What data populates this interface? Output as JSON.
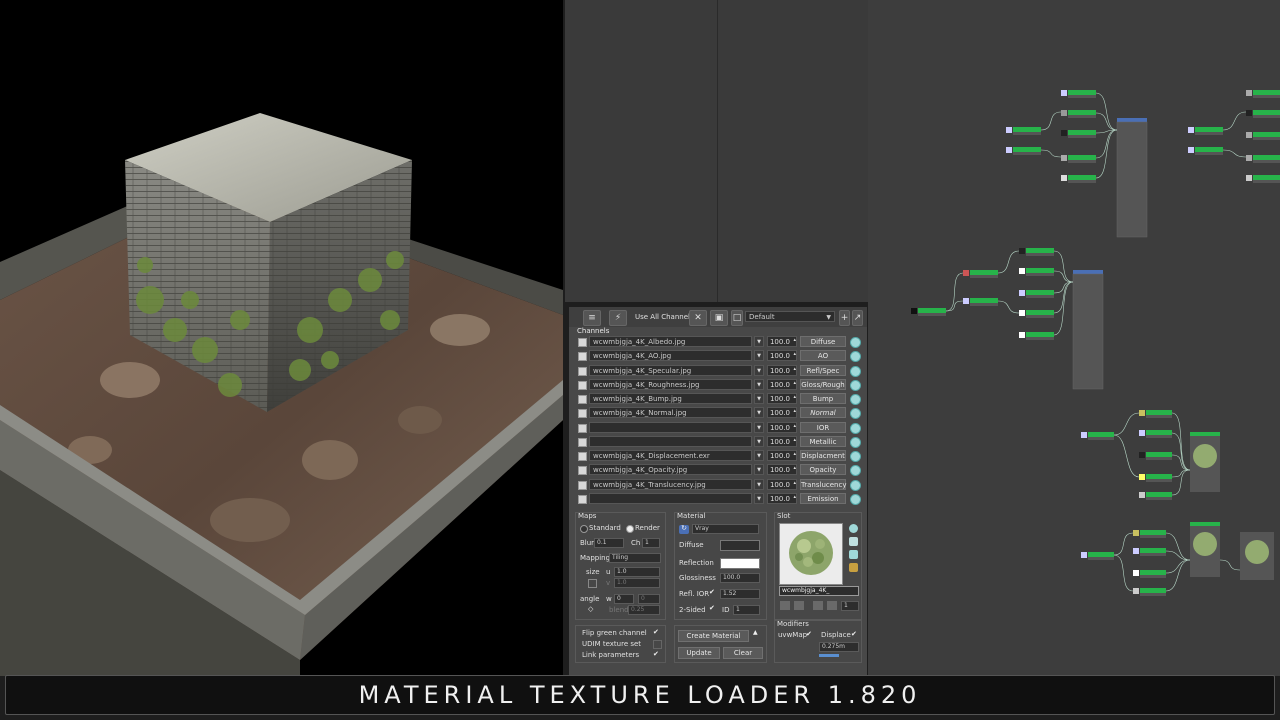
{
  "toolbar": {
    "use_all_channels": "Use All Channels",
    "preset": "Default"
  },
  "channels": {
    "title": "Channels",
    "rows": [
      {
        "file": "wcwmbjgja_4K_Albedo.jpg",
        "value": "100.0",
        "channel": "Diffuse"
      },
      {
        "file": "wcwmbjgja_4K_AO.jpg",
        "value": "100.0",
        "channel": "AO"
      },
      {
        "file": "wcwmbjgja_4K_Specular.jpg",
        "value": "100.0",
        "channel": "Refl/Spec"
      },
      {
        "file": "wcwmbjgja_4K_Roughness.jpg",
        "value": "100.0",
        "channel": "Gloss/Rough"
      },
      {
        "file": "wcwmbjgja_4K_Bump.jpg",
        "value": "100.0",
        "channel": "Bump"
      },
      {
        "file": "wcwmbjgja_4K_Normal.jpg",
        "value": "100.0",
        "channel": "Normal"
      },
      {
        "file": "",
        "value": "100.0",
        "channel": "IOR"
      },
      {
        "file": "",
        "value": "100.0",
        "channel": "Metallic"
      },
      {
        "file": "wcwmbjgja_4K_Displacement.exr",
        "value": "100.0",
        "channel": "Displacment"
      },
      {
        "file": "wcwmbjgja_4K_Opacity.jpg",
        "value": "100.0",
        "channel": "Opacity"
      },
      {
        "file": "wcwmbjgja_4K_Translucency.jpg",
        "value": "100.0",
        "channel": "Translucency"
      },
      {
        "file": "",
        "value": "100.0",
        "channel": "Emission"
      }
    ]
  },
  "maps": {
    "title": "Maps",
    "standard": "Standard",
    "render": "Render",
    "blur_label": "Blur",
    "blur_value": "0.1",
    "ch_label": "Ch",
    "ch_value": "1",
    "mapping_label": "Mapping",
    "mapping_value": "Tiling",
    "size_label": "size",
    "u_label": "u",
    "u_value": "1.0",
    "v_label": "v",
    "v_value": "1.0",
    "angle_label": "angle",
    "w_label": "w",
    "w_value": "0",
    "w2_value": "0",
    "blend_label": "blend",
    "blend_value": "0.25"
  },
  "material": {
    "title": "Material",
    "renderer": "Vray",
    "diffuse_label": "Diffuse",
    "reflection_label": "Reflection",
    "glossiness_label": "Glossiness",
    "glossiness_value": "100.0",
    "refl_ior_label": "Refl. IOR",
    "refl_ior_value": "1.52",
    "two_sided_label": "2-Sided",
    "id_label": "ID",
    "id_value": "1",
    "diffuse_color": "#2e2e2e",
    "reflection_color": "#ffffff"
  },
  "slot": {
    "title": "Slot",
    "name_value": "wcwmbjgja_4K_",
    "slot_number": "1"
  },
  "options": {
    "flip_green": "Flip green channel",
    "udim": "UDIM texture set",
    "link_params": "Link parameters"
  },
  "actions": {
    "create": "Create Material",
    "update": "Update",
    "clear": "Clear"
  },
  "modifiers": {
    "title": "Modifiers",
    "uvw_map": "uvwMap",
    "displace": "Displace",
    "displace_value": "0.275m"
  },
  "banner": {
    "title": "MATERIAL TEXTURE LOADER 1.820"
  },
  "colors": {
    "node_green": "#27b34a",
    "node_header_blue": "#4a6fb5",
    "accent_teal": "#9fd8d8"
  }
}
